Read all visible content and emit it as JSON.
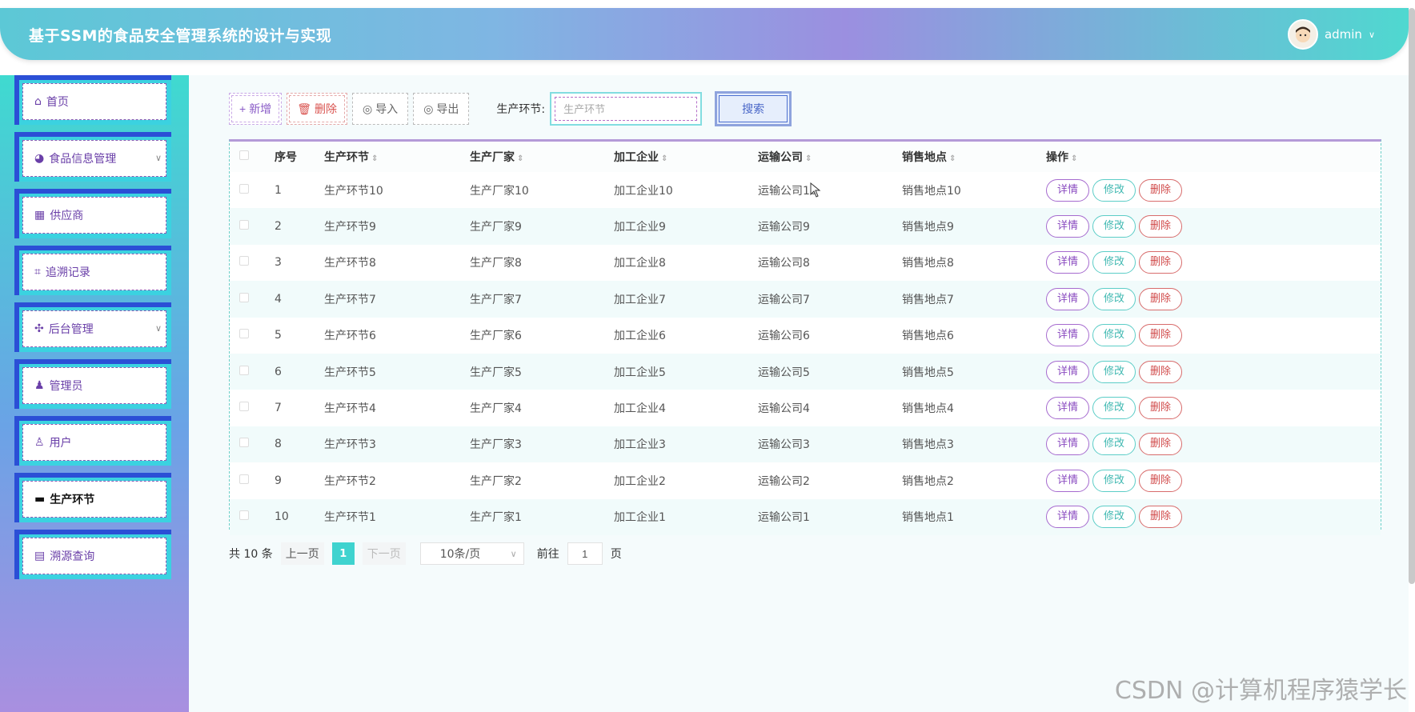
{
  "header": {
    "title": "基于SSM的食品安全管理系统的设计与实现",
    "username": "admin"
  },
  "sidebar": {
    "items": [
      {
        "label": "首页",
        "icon": "home-icon",
        "has_caret": false,
        "active": false
      },
      {
        "label": "食品信息管理",
        "icon": "pie-icon",
        "has_caret": true,
        "active": false
      },
      {
        "label": "供应商",
        "icon": "grid-icon",
        "has_caret": false,
        "active": false
      },
      {
        "label": "追溯记录",
        "icon": "crop-icon",
        "has_caret": false,
        "active": false
      },
      {
        "label": "后台管理",
        "icon": "cog-cluster-icon",
        "has_caret": true,
        "active": false
      },
      {
        "label": "管理员",
        "icon": "user-icon",
        "has_caret": false,
        "active": false
      },
      {
        "label": "用户",
        "icon": "user-badge-icon",
        "has_caret": false,
        "active": false
      },
      {
        "label": "生产环节",
        "icon": "ticket-icon",
        "has_caret": false,
        "active": true
      },
      {
        "label": "溯源查询",
        "icon": "card-icon",
        "has_caret": false,
        "active": false
      }
    ]
  },
  "toolbar": {
    "add_label": "新增",
    "delete_label": "删除",
    "import_label": "导入",
    "export_label": "导出",
    "filter_label": "生产环节:",
    "filter_placeholder": "生产环节",
    "search_label": "搜索"
  },
  "table": {
    "headers": [
      "序号",
      "生产环节",
      "生产厂家",
      "加工企业",
      "运输公司",
      "销售地点",
      "操作"
    ],
    "rows": [
      [
        "1",
        "生产环节10",
        "生产厂家10",
        "加工企业10",
        "运输公司10",
        "销售地点10"
      ],
      [
        "2",
        "生产环节9",
        "生产厂家9",
        "加工企业9",
        "运输公司9",
        "销售地点9"
      ],
      [
        "3",
        "生产环节8",
        "生产厂家8",
        "加工企业8",
        "运输公司8",
        "销售地点8"
      ],
      [
        "4",
        "生产环节7",
        "生产厂家7",
        "加工企业7",
        "运输公司7",
        "销售地点7"
      ],
      [
        "5",
        "生产环节6",
        "生产厂家6",
        "加工企业6",
        "运输公司6",
        "销售地点6"
      ],
      [
        "6",
        "生产环节5",
        "生产厂家5",
        "加工企业5",
        "运输公司5",
        "销售地点5"
      ],
      [
        "7",
        "生产环节4",
        "生产厂家4",
        "加工企业4",
        "运输公司4",
        "销售地点4"
      ],
      [
        "8",
        "生产环节3",
        "生产厂家3",
        "加工企业3",
        "运输公司3",
        "销售地点3"
      ],
      [
        "9",
        "生产环节2",
        "生产厂家2",
        "加工企业2",
        "运输公司2",
        "销售地点2"
      ],
      [
        "10",
        "生产环节1",
        "生产厂家1",
        "加工企业1",
        "运输公司1",
        "销售地点1"
      ]
    ],
    "action_labels": {
      "detail": "详情",
      "edit": "修改",
      "delete": "删除"
    }
  },
  "pager": {
    "total": "共 10 条",
    "prev": "上一页",
    "current": "1",
    "next": "下一页",
    "size": "10条/页",
    "goto_label": "前往",
    "goto_value": "1",
    "page_suffix": "页"
  },
  "watermark": "CSDN @计算机程序猿学长",
  "colors": {
    "accent": "#3fd3cf",
    "sidebar_border": "#2b4fd6",
    "menu_text": "#6a3fa8",
    "danger": "#d14b4b"
  }
}
